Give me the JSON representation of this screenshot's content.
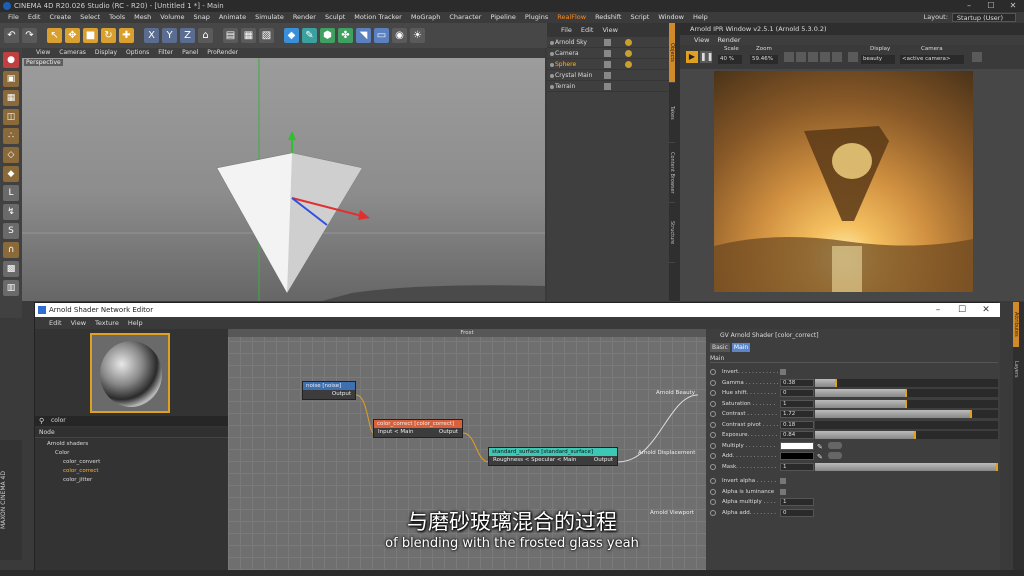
{
  "app": {
    "window_title": "CINEMA 4D R20.026 Studio (RC - R20) - [Untitled 1 *] - Main",
    "layout_label": "Layout:",
    "layout_value": "Startup (User)"
  },
  "menubar": [
    "File",
    "Edit",
    "Create",
    "Select",
    "Tools",
    "Mesh",
    "Volume",
    "Snap",
    "Animate",
    "Simulate",
    "Render",
    "Sculpt",
    "Motion Tracker",
    "MoGraph",
    "Character",
    "Pipeline",
    "Plugins",
    "RealFlow",
    "Redshift",
    "Script",
    "Window",
    "Help"
  ],
  "menubar_highlight": "RealFlow",
  "viewport": {
    "menu": [
      "View",
      "Cameras",
      "Display",
      "Options",
      "Filter",
      "Panel",
      "ProRender"
    ],
    "label": "Perspective"
  },
  "object_manager": {
    "menu": [
      "File",
      "Edit",
      "View"
    ],
    "objects": [
      {
        "name": "Arnold Sky"
      },
      {
        "name": "Camera"
      },
      {
        "name": "Sphere",
        "highlight": true
      },
      {
        "name": "Crystal Main"
      },
      {
        "name": "Terrain"
      }
    ]
  },
  "side_tabs": [
    "Objects",
    "Takes",
    "Content Browser",
    "Structure"
  ],
  "ipr": {
    "title": "Arnold IPR Window v2.5.1 (Arnold 5.3.0.2)",
    "menu": [
      "View",
      "Render"
    ],
    "scale_label": "Scale",
    "scale_value": "40 %",
    "zoom_label": "Zoom",
    "zoom_value": "59.46%",
    "display_label": "Display",
    "display_value": "beauty",
    "camera_label": "Camera",
    "camera_value": "<active camera>"
  },
  "shader_editor": {
    "title": "Arnold Shader Network Editor",
    "menu": [
      "Edit",
      "View",
      "Texture",
      "Help"
    ],
    "search_value": "color",
    "node_header": "Node",
    "tree": [
      {
        "label": "Arnold shaders",
        "indent": 1
      },
      {
        "label": "Color",
        "indent": 2
      },
      {
        "label": "color_convert",
        "indent": 3
      },
      {
        "label": "color_correct",
        "indent": 3,
        "highlight": true
      },
      {
        "label": "color_jitter",
        "indent": 3
      }
    ],
    "canvas_title": "Frost",
    "nodes": [
      {
        "title": "noise [noise]",
        "port_right": "Output",
        "port_left": "",
        "color": "#3e6fb0"
      },
      {
        "title": "color_correct [color_correct]",
        "port_left": "Input < Main",
        "port_right": "Output",
        "color": "#d9603a"
      },
      {
        "title": "standard_surface [standard_surface]",
        "port_left": "Roughness < Specular < Main",
        "port_right": "Output",
        "color": "#3cc8b4"
      }
    ],
    "outputs": [
      "Arnold Beauty",
      "Arnold Displacement",
      "Arnold Viewport"
    ]
  },
  "attributes": {
    "title": "GV Arnold Shader [color_correct]",
    "tabs": [
      "Basic",
      "Main"
    ],
    "active_tab": "Main",
    "section": "Main",
    "rows": [
      {
        "label": "Invert. . . . . . . . . . . .",
        "type": "check"
      },
      {
        "label": "Gamma . . . . . . . . . .",
        "value": "0.38",
        "fill": 0.12
      },
      {
        "label": "Hue shift. . . . . . . . .",
        "value": "0",
        "fill": 0.5
      },
      {
        "label": "Saturation . . . . . . .",
        "value": "1",
        "fill": 0.5
      },
      {
        "label": "Contrast . . . . . . . . .",
        "value": "1.72",
        "fill": 0.86
      },
      {
        "label": "Contrast pivot . . . . .",
        "value": "0.18",
        "fill": 0
      },
      {
        "label": "Exposure. . . . . . . . .",
        "value": "0.84",
        "fill": 0.55
      },
      {
        "label": "Multiply . . . . . . . . .",
        "type": "color",
        "color": "#ffffff"
      },
      {
        "label": "Add. . . . . . . . . . . . .",
        "type": "color",
        "color": "#000000"
      },
      {
        "label": "Mask. . . . . . . . . . . .",
        "value": "1",
        "fill": 1
      },
      {
        "label": "Invert alpha . . . . . .",
        "type": "check"
      },
      {
        "label": "Alpha is luminance",
        "type": "check"
      },
      {
        "label": "Alpha multiply . . . .",
        "value": "1",
        "type": "short"
      },
      {
        "label": "Alpha add. . . . . . . .",
        "value": "0",
        "type": "short"
      }
    ]
  },
  "right_tabs": [
    "Attributes",
    "Layers"
  ],
  "maxon_label": "MAXON CINEMA 4D",
  "subtitles": {
    "chinese": "与磨砂玻璃混合的过程",
    "english": "of blending with the frosted glass yeah"
  }
}
